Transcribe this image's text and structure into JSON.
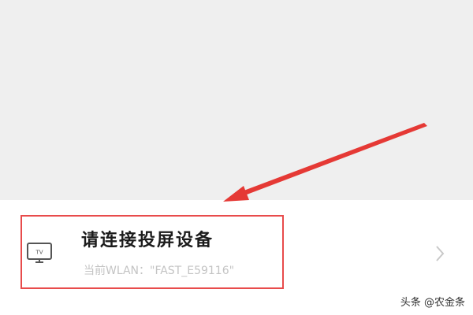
{
  "colors": {
    "top_background": "#efefef",
    "row_background": "#ffffff",
    "highlight_border": "#e84b4b",
    "arrow": "#e53935",
    "subtitle_text": "#c4c4c4"
  },
  "device_row": {
    "icon": "tv-icon",
    "icon_label": "TV",
    "title": "请连接投屏设备",
    "subtitle": "当前WLAN：\"FAST_E59116\"",
    "chevron_icon": "chevron-right-icon"
  },
  "watermark": {
    "text": "头条 @农金条"
  }
}
